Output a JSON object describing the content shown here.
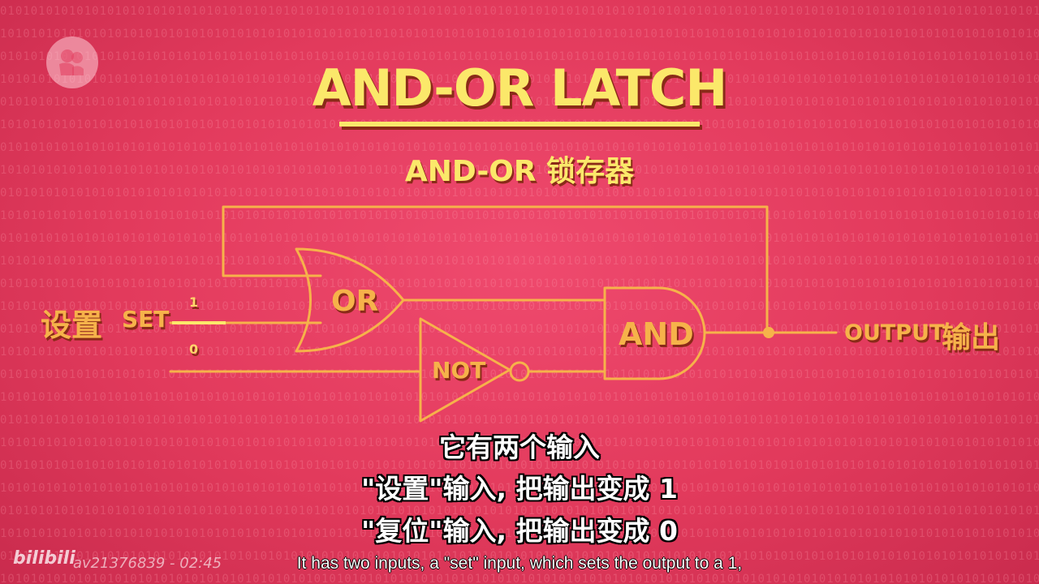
{
  "background_pattern": "0101",
  "logo": {
    "icon": "pbs-logo-icon"
  },
  "title": "AND-OR LATCH",
  "subtitle": "AND-OR 锁存器",
  "diagram": {
    "set_label_cn": "设置",
    "set_label_en": "SET",
    "bit_one": "1",
    "bit_zero": "0",
    "gate_or": "OR",
    "gate_not": "NOT",
    "gate_and": "AND",
    "output_label_en": "OUTPUT",
    "output_label_cn": "输出"
  },
  "subtitles": {
    "cn_line1": "它有两个输入",
    "cn_line2": "\"设置\"输入, 把输出变成 1",
    "cn_line3": "\"复位\"输入, 把输出变成 0",
    "en_line": "It has two inputs, a \"set\" input, which sets the output to a 1,"
  },
  "watermark": {
    "logo_text": "bilibili",
    "video_id": "av21376839 - 02:45"
  },
  "colors": {
    "background": "#e23a5c",
    "title": "#fbe86a",
    "circuit": "#f6b24a",
    "set_wire_active": "#fbe86a"
  }
}
